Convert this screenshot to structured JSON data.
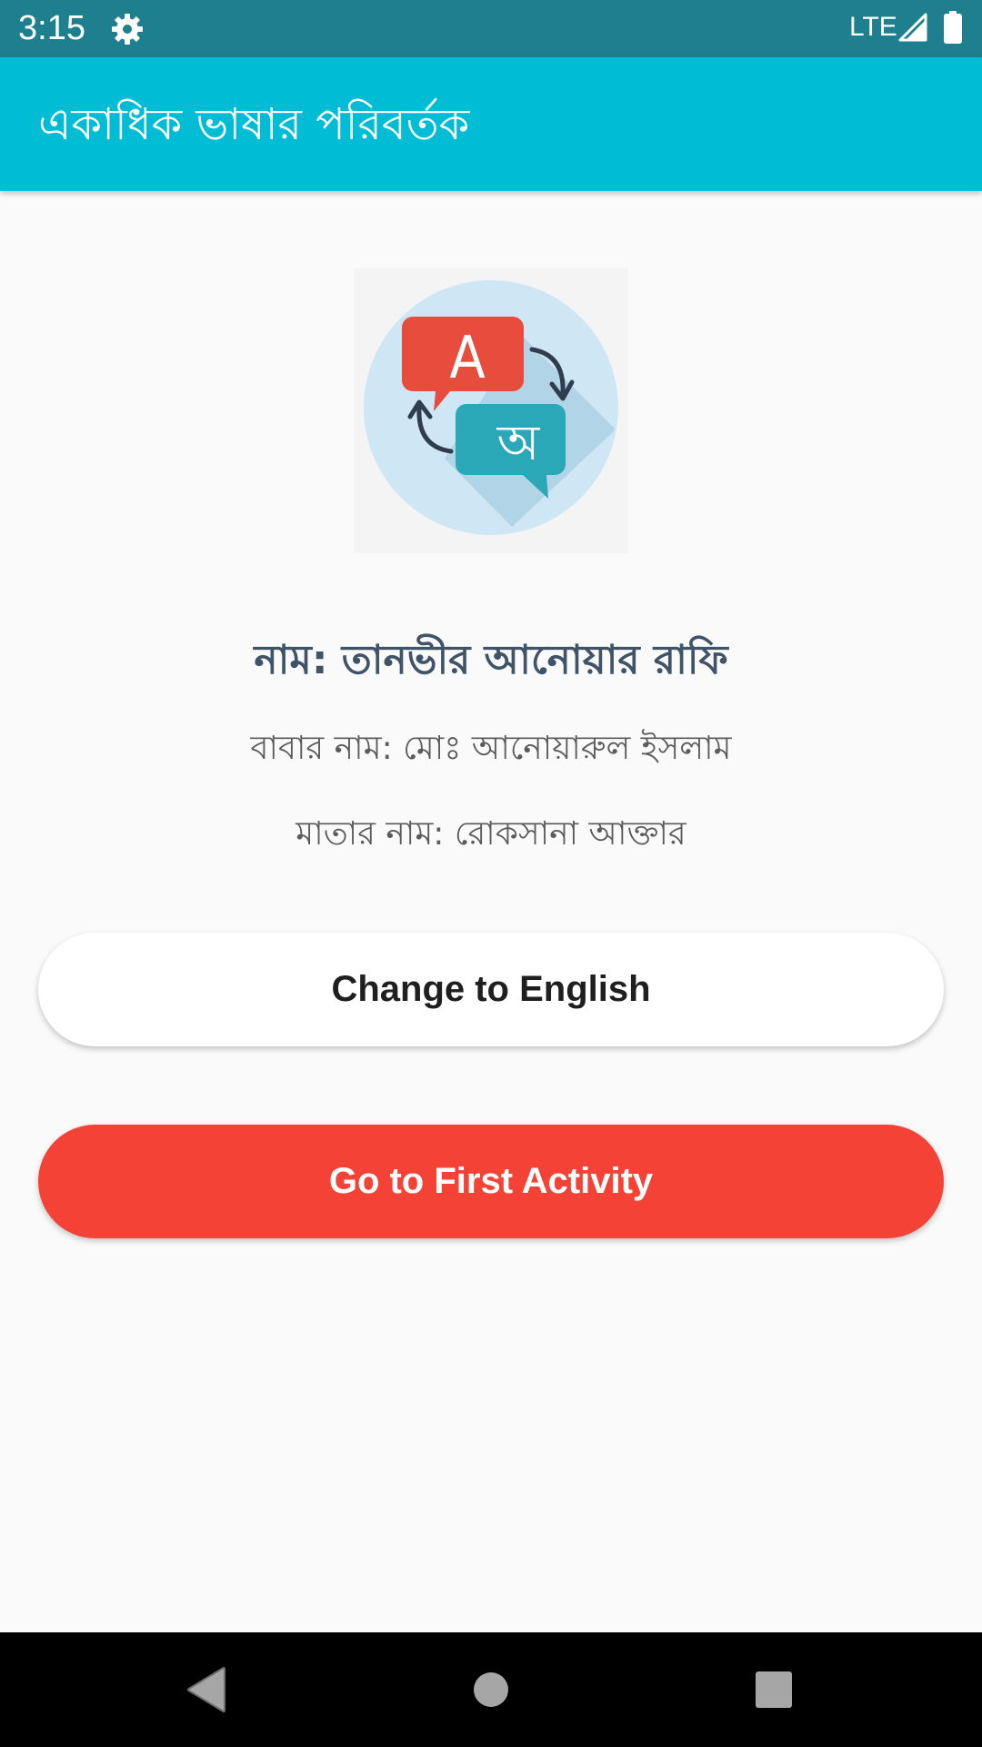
{
  "status_bar": {
    "time": "3:15",
    "network": "LTE",
    "color": "#1e7f8f",
    "icons": [
      "gear-icon",
      "signal-icon",
      "battery-icon"
    ]
  },
  "app_bar": {
    "title": "একাধিক ভাষার পরিবর্তক",
    "color": "#00bcd4"
  },
  "logo": {
    "icon": "translate-icon",
    "letter_a": "A",
    "letter_bn": "অ"
  },
  "profile": {
    "name": "নাম: তানভীর আনোয়ার রাফি",
    "father": "বাবার নাম: মোঃ আনোয়ারুল ইসলাম",
    "mother": "মাতার নাম: রোকসানা আক্তার"
  },
  "buttons": {
    "change_language": "Change to English",
    "first_activity": "Go to First Activity"
  },
  "colors": {
    "accent": "#f44336",
    "name_text": "#3f5468"
  },
  "nav_bar": {
    "icons": [
      "back-icon",
      "home-icon",
      "recents-icon"
    ]
  }
}
